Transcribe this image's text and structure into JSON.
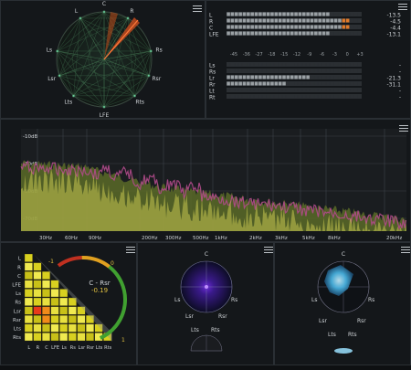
{
  "surround_scope": {
    "channels": [
      "L",
      "C",
      "R",
      "Ls",
      "Rs",
      "Lsr",
      "Rsr",
      "Lts",
      "Rts",
      "LFE"
    ]
  },
  "level_meter": {
    "group1": [
      {
        "label": "L",
        "value": "-13.5",
        "level": 0.78
      },
      {
        "label": "R",
        "value": "-4.5",
        "level": 0.93
      },
      {
        "label": "C",
        "value": "-4.4",
        "level": 0.93
      },
      {
        "label": "LFE",
        "value": "-13.1",
        "level": 0.79
      }
    ],
    "scale": [
      "-45",
      "-36",
      "-27",
      "-18",
      "-15",
      "-12",
      "-9",
      "-6",
      "-3",
      "0",
      "+3"
    ],
    "group2": [
      {
        "label": "Ls",
        "value": "-",
        "level": 0.0
      },
      {
        "label": "Rs",
        "value": "-",
        "level": 0.0
      },
      {
        "label": "Lr",
        "value": "-21.3",
        "level": 0.63
      },
      {
        "label": "Rr",
        "value": "-31.1",
        "level": 0.47
      },
      {
        "label": "Lt",
        "value": "-",
        "level": 0.0
      },
      {
        "label": "Rt",
        "value": "-",
        "level": 0.0
      }
    ]
  },
  "spectrum": {
    "db_labels": [
      "-10dB",
      "-30dB",
      "-50dB",
      "-70dB"
    ],
    "freq_labels": [
      "30Hz",
      "60Hz",
      "90Hz",
      "200Hz",
      "300Hz",
      "500Hz",
      "1kHz",
      "2kHz",
      "3kHz",
      "5kHz",
      "8kHz",
      "20kHz"
    ]
  },
  "correlation": {
    "channel_labels": [
      "L",
      "R",
      "C",
      "LFE",
      "Ls",
      "Rs",
      "Lsr",
      "Rsr",
      "Lts",
      "Rts"
    ],
    "pair": "C - Rsr",
    "value": "-0.19",
    "scale_min": "-1",
    "scale_mid": "0",
    "scale_max": "1"
  },
  "vectorscope1": {
    "top": "C",
    "left": "Ls",
    "right": "Rs",
    "bl": "Lsr",
    "br": "Rsr",
    "lts": "Lts",
    "rts": "Rts"
  },
  "vectorscope2": {
    "top": "C",
    "left": "Ls",
    "right": "Rs",
    "bl": "Lsr",
    "br": "Rsr",
    "lts": "Lts",
    "rts": "Rts"
  }
}
